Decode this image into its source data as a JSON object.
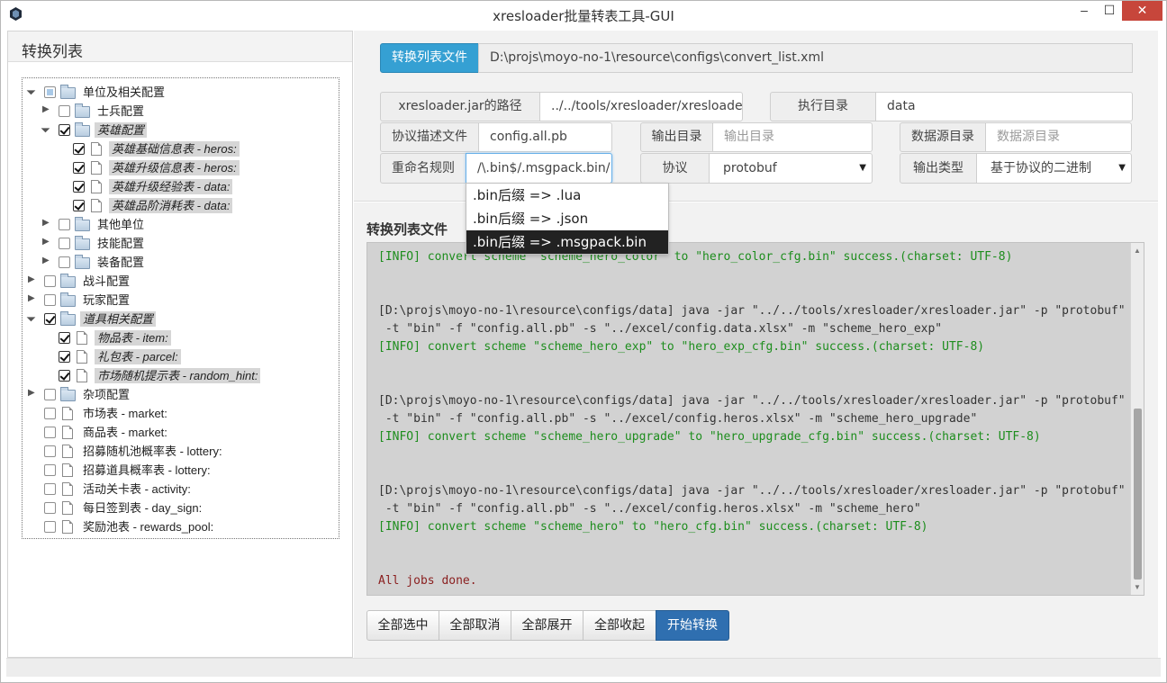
{
  "window": {
    "title": "xresloader批量转表工具-GUI",
    "min": "–",
    "max": "☐",
    "close": "✕"
  },
  "left": {
    "title": "转换列表",
    "tree": [
      {
        "label": "单位及相关配置",
        "level": 0,
        "type": "folder",
        "expanded": true,
        "state": "partial",
        "selected": false
      },
      {
        "label": "士兵配置",
        "level": 1,
        "type": "folder",
        "expanded": false,
        "state": "none",
        "selected": false
      },
      {
        "label": "英雄配置",
        "level": 1,
        "type": "folder",
        "expanded": true,
        "state": "checked",
        "selected": true
      },
      {
        "label": "英雄基础信息表 - heros:",
        "level": 2,
        "type": "file",
        "state": "checked",
        "selected": true
      },
      {
        "label": "英雄升级信息表 - heros:",
        "level": 2,
        "type": "file",
        "state": "checked",
        "selected": true
      },
      {
        "label": "英雄升级经验表 - data:",
        "level": 2,
        "type": "file",
        "state": "checked",
        "selected": true
      },
      {
        "label": "英雄品阶消耗表 - data:",
        "level": 2,
        "type": "file",
        "state": "checked",
        "selected": true
      },
      {
        "label": "其他单位",
        "level": 1,
        "type": "folder",
        "expanded": false,
        "state": "none",
        "selected": false
      },
      {
        "label": "技能配置",
        "level": 1,
        "type": "folder",
        "expanded": false,
        "state": "none",
        "selected": false
      },
      {
        "label": "装备配置",
        "level": 1,
        "type": "folder",
        "expanded": false,
        "state": "none",
        "selected": false
      },
      {
        "label": "战斗配置",
        "level": 0,
        "type": "folder",
        "expanded": false,
        "state": "none",
        "selected": false
      },
      {
        "label": "玩家配置",
        "level": 0,
        "type": "folder",
        "expanded": false,
        "state": "none",
        "selected": false
      },
      {
        "label": "道具相关配置",
        "level": 0,
        "type": "folder",
        "expanded": true,
        "state": "checked",
        "selected": true
      },
      {
        "label": "物品表 - item:",
        "level": 1,
        "type": "file",
        "state": "checked",
        "selected": true
      },
      {
        "label": "礼包表 - parcel:",
        "level": 1,
        "type": "file",
        "state": "checked",
        "selected": true
      },
      {
        "label": "市场随机提示表 - random_hint:",
        "level": 1,
        "type": "file",
        "state": "checked",
        "selected": true
      },
      {
        "label": "杂项配置",
        "level": 0,
        "type": "folder",
        "expanded": false,
        "state": "none",
        "selected": false
      },
      {
        "label": "市场表 - market:",
        "level": 0,
        "type": "file",
        "state": "none",
        "selected": false
      },
      {
        "label": "商品表 - market:",
        "level": 0,
        "type": "file",
        "state": "none",
        "selected": false
      },
      {
        "label": "招募随机池概率表 - lottery:",
        "level": 0,
        "type": "file",
        "state": "none",
        "selected": false
      },
      {
        "label": "招募道具概率表 - lottery:",
        "level": 0,
        "type": "file",
        "state": "none",
        "selected": false
      },
      {
        "label": "活动关卡表 - activity:",
        "level": 0,
        "type": "file",
        "state": "none",
        "selected": false
      },
      {
        "label": "每日签到表 - day_sign:",
        "level": 0,
        "type": "file",
        "state": "none",
        "selected": false
      },
      {
        "label": "奖励池表 - rewards_pool:",
        "level": 0,
        "type": "file",
        "state": "none",
        "selected": false
      }
    ]
  },
  "form": {
    "convert_list_button": "转换列表文件",
    "convert_list_path": "D:\\projs\\moyo-no-1\\resource\\configs\\convert_list.xml",
    "jar_label": "xresloader.jar的路径",
    "jar_value": "../../tools/xresloader/xresloader.",
    "exec_dir_label": "执行目录",
    "exec_dir_value": "data",
    "proto_desc_label": "协议描述文件",
    "proto_desc_value": "config.all.pb",
    "output_dir_label": "输出目录",
    "output_dir_placeholder": "输出目录",
    "data_src_label": "数据源目录",
    "data_src_placeholder": "数据源目录",
    "rename_label": "重命名规则",
    "rename_value": "/\\.bin$/.msgpack.bin/",
    "protocol_label": "协议",
    "protocol_value": "protobuf",
    "output_type_label": "输出类型",
    "output_type_value": "基于协议的二进制",
    "caret": "▼"
  },
  "rename_suggestions": [
    {
      "text": ".bin后缀 => .lua",
      "active": false
    },
    {
      "text": ".bin后缀 => .json",
      "active": false
    },
    {
      "text": ".bin后缀 => .msgpack.bin",
      "active": true
    }
  ],
  "log": {
    "title": "转换列表文件",
    "lines": [
      {
        "kind": "info",
        "text": "[INFO] convert scheme \"scheme_hero_color\" to \"hero_color_cfg.bin\" success.(charset: UTF-8)"
      },
      {
        "kind": "blank",
        "text": ""
      },
      {
        "kind": "blank",
        "text": ""
      },
      {
        "kind": "cmd",
        "text": "[D:\\projs\\moyo-no-1\\resource\\configs/data] java -jar \"../../tools/xresloader/xresloader.jar\" -p \"protobuf\""
      },
      {
        "kind": "cmd",
        "text": " -t \"bin\" -f \"config.all.pb\" -s \"../excel/config.data.xlsx\" -m \"scheme_hero_exp\""
      },
      {
        "kind": "info",
        "text": "[INFO] convert scheme \"scheme_hero_exp\" to \"hero_exp_cfg.bin\" success.(charset: UTF-8)"
      },
      {
        "kind": "blank",
        "text": ""
      },
      {
        "kind": "blank",
        "text": ""
      },
      {
        "kind": "cmd",
        "text": "[D:\\projs\\moyo-no-1\\resource\\configs/data] java -jar \"../../tools/xresloader/xresloader.jar\" -p \"protobuf\""
      },
      {
        "kind": "cmd",
        "text": " -t \"bin\" -f \"config.all.pb\" -s \"../excel/config.heros.xlsx\" -m \"scheme_hero_upgrade\""
      },
      {
        "kind": "info",
        "text": "[INFO] convert scheme \"scheme_hero_upgrade\" to \"hero_upgrade_cfg.bin\" success.(charset: UTF-8)"
      },
      {
        "kind": "blank",
        "text": ""
      },
      {
        "kind": "blank",
        "text": ""
      },
      {
        "kind": "cmd",
        "text": "[D:\\projs\\moyo-no-1\\resource\\configs/data] java -jar \"../../tools/xresloader/xresloader.jar\" -p \"protobuf\""
      },
      {
        "kind": "cmd",
        "text": " -t \"bin\" -f \"config.all.pb\" -s \"../excel/config.heros.xlsx\" -m \"scheme_hero\""
      },
      {
        "kind": "info",
        "text": "[INFO] convert scheme \"scheme_hero\" to \"hero_cfg.bin\" success.(charset: UTF-8)"
      },
      {
        "kind": "blank",
        "text": ""
      },
      {
        "kind": "blank",
        "text": ""
      },
      {
        "kind": "done",
        "text": "All jobs done."
      }
    ]
  },
  "actions": {
    "select_all": "全部选中",
    "deselect_all": "全部取消",
    "expand_all": "全部展开",
    "collapse_all": "全部收起",
    "start": "开始转换"
  },
  "colors": {
    "accent": "#35a0d3",
    "primary": "#2f6fb0",
    "info_text": "#1d8d1d",
    "done_text": "#8a1f1f",
    "close_button": "#c7463b"
  }
}
